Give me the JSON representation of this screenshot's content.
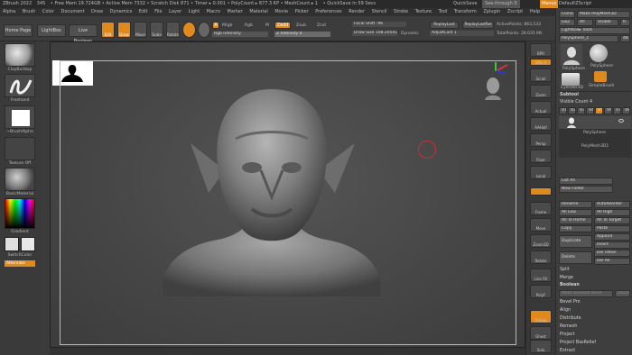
{
  "titlebar": {
    "items": [
      "ZBrush 2022",
      "345",
      "• Free Mem 19.724GB • Active Mem 7332 • Scratch Disk 871 • Timer ▸ 0.001 • PolyCount ▸ 877.3 KP • MeshCount ▸ 1",
      "• QuickSave In 59 Secs"
    ],
    "quicksave": "QuickSave",
    "seethrough": "See-through 0",
    "menus": "Menus",
    "script": "DefaultZScript"
  },
  "menubar": {
    "items": [
      "Alpha",
      "Brush",
      "Color",
      "Document",
      "Draw",
      "Dynamics",
      "Edit",
      "File",
      "Layer",
      "Light",
      "Macro",
      "Marker",
      "Material",
      "Movie",
      "Picker",
      "Preferences",
      "Render",
      "Stencil",
      "Stroke",
      "Texture",
      "Tool",
      "Transform",
      "Zplugin",
      "Zscript",
      "Help"
    ]
  },
  "toolbar": {
    "home": "Home Page",
    "lightbox": "LightBox",
    "liveboolean": "Live Boolean",
    "edit": "Edit",
    "draw": "Draw",
    "move": "Move",
    "scale": "Scale",
    "rotate": "Rotate",
    "a": "A",
    "mrgb": "Mrgb",
    "rgb": "Rgb",
    "m": "M",
    "zadd": "Zadd",
    "zsub": "Zsub",
    "zcut": "Zcut",
    "rgb_intensity": "Rgb Intensity",
    "z_intensity": "Z Intensity 4",
    "focal_shift": "Focal Shift -96",
    "draw_size": "Draw Size 108.20541",
    "dynamic": "Dynamic",
    "replay_last": "ReplayLast",
    "replay_last_rel": "ReplayLastRel",
    "adjust_last": "AdjustLast 1",
    "active_points": "ActivePoints: 863,533",
    "total_points": "TotalPoints: 28.035 Mil"
  },
  "leftshelf": {
    "brush": "ClayBuildup",
    "stroke": "Freehand",
    "alpha": "~BrushAlpha",
    "texture": "Texture Off",
    "material": "BasicMaterial",
    "gradient": "Gradient",
    "switchcolor": "SwitchColor",
    "alternate": "Alternate"
  },
  "rightstrip": {
    "items": [
      "BPR",
      "SPix 3",
      "Scroll",
      "Zoom",
      "Actual",
      "AAHalf",
      "Persp",
      "Floor",
      "Local",
      "Frame",
      "Move",
      "Zoom3D",
      "Rotate",
      "Line Fill",
      "PolyF",
      "Transp",
      "Ghost",
      "Solo",
      "Xpose"
    ]
  },
  "rpanel": {
    "clone": "Clone",
    "make_polymesh": "Make PolyMesh3D",
    "goz": "GoZ",
    "all": "All",
    "visible": "Visible",
    "r": "R",
    "lightbox_tools": "Lightbox▸ Tools",
    "tool_name": "PolySphere_1",
    "tool_count": "48",
    "tools": [
      "PolySphere",
      "PolySphere",
      "Cylinder3D",
      "SimpleBrush"
    ],
    "subtool_header": "Subtool",
    "visible_count": "Visible Count 4",
    "v_buttons": [
      "V1",
      "V2",
      "V3",
      "V4",
      "V5",
      "V6",
      "V7",
      "V8"
    ],
    "subtool_items": [
      "PolySphere",
      "PolyMesh3D1"
    ],
    "list_all": "List All",
    "new_folder": "New Folder",
    "rename": "Rename",
    "autoreorder": "AutoReorder",
    "all_low": "All Low",
    "all_high": "All High",
    "all_to_home": "All To Home",
    "all_to_target": "All To Target",
    "copy": "Copy",
    "paste": "Paste",
    "duplicate": "Duplicate",
    "append": "Append",
    "insert": "Insert",
    "delete": "Delete",
    "del_other": "Del Other",
    "del_all": "Del All",
    "split": "Split",
    "merge": "Merge",
    "boolean": "Boolean",
    "make_boolean_mesh": "Make Boolean Mesh",
    "dyn_ss": "DSDiv",
    "bevel_pro": "Bevel Pro",
    "align": "Align",
    "distribute": "Distribute",
    "remesh": "Remesh",
    "project": "Project",
    "project_bas_relief": "Project BasRelief",
    "extract": "Extract"
  },
  "colors": {
    "accent": "#e08a1e",
    "canvas": "#4a4a4a",
    "panel": "#3e3e3e"
  }
}
